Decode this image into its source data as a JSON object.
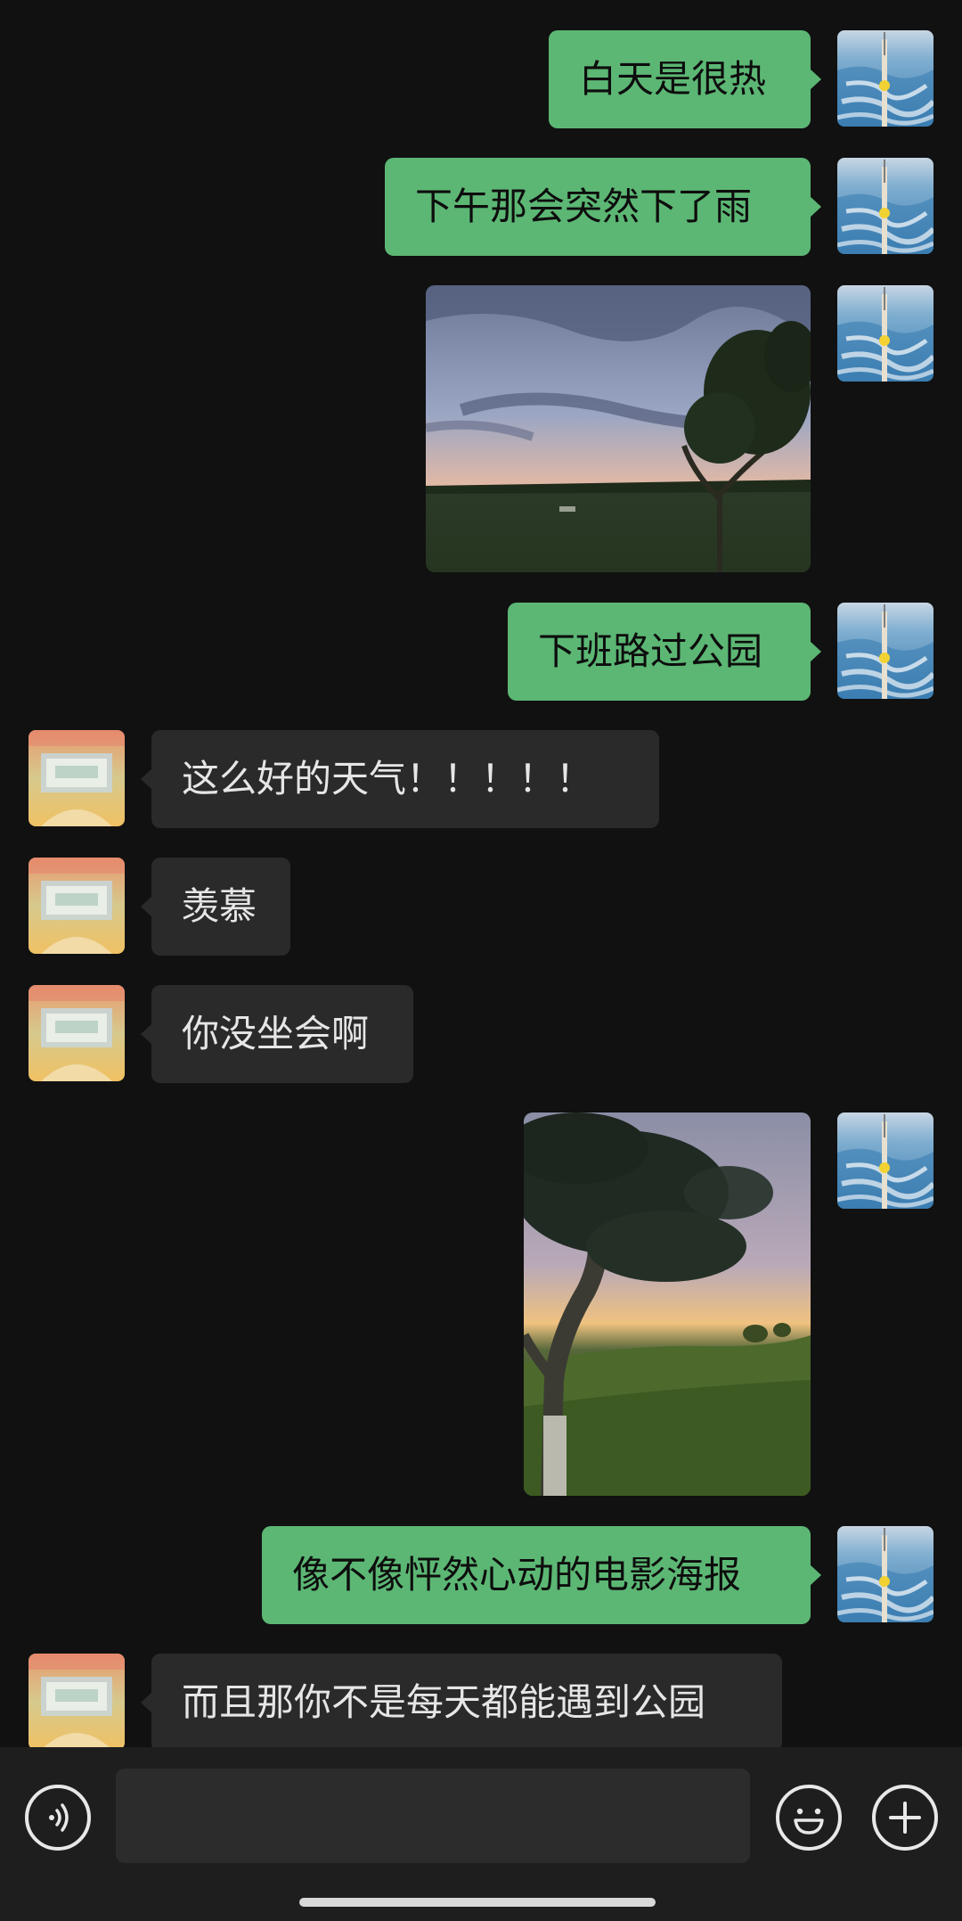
{
  "messages": [
    {
      "from": "me",
      "type": "text",
      "text": "白天是很热"
    },
    {
      "from": "me",
      "type": "text",
      "text": "下午那会突然下了雨"
    },
    {
      "from": "me",
      "type": "image",
      "subject": "park-sunset-landscape"
    },
    {
      "from": "me",
      "type": "text",
      "text": "下班路过公园"
    },
    {
      "from": "other",
      "type": "text",
      "text": "这么好的天气！！！！！"
    },
    {
      "from": "other",
      "type": "text",
      "text": "羡慕"
    },
    {
      "from": "other",
      "type": "text",
      "text": "你没坐会啊"
    },
    {
      "from": "me",
      "type": "image",
      "subject": "tree-on-hill-sunset"
    },
    {
      "from": "me",
      "type": "text",
      "text": "像不像怦然心动的电影海报"
    },
    {
      "from": "other",
      "type": "text",
      "text": "而且那你不是每天都能遇到公园"
    }
  ],
  "input_bar": {
    "voice_icon": "voice-icon",
    "emoji_icon": "emoji-icon",
    "plus_icon": "plus-icon",
    "input_value": ""
  },
  "colors": {
    "background": "#111111",
    "my_bubble": "#5cb774",
    "their_bubble": "#2a2a2a",
    "input_bar": "#1e1e1e"
  }
}
